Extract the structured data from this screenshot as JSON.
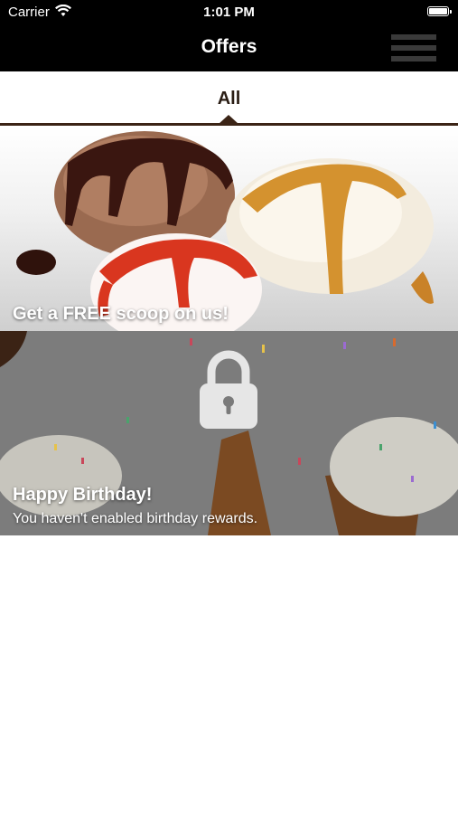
{
  "status_bar": {
    "carrier": "Carrier",
    "time": "1:01 PM"
  },
  "header": {
    "title": "Offers",
    "menu_icon": "hamburger-menu-icon"
  },
  "tabs": [
    {
      "label": "All",
      "selected": true
    }
  ],
  "offers": [
    {
      "title": "Get a FREE scoop on us!",
      "subtitle": "",
      "locked": false
    },
    {
      "title": "Happy Birthday!",
      "subtitle": "You haven't enabled birthday rewards.",
      "locked": true
    }
  ],
  "colors": {
    "bar": "#000000",
    "accent": "#3b2416"
  }
}
